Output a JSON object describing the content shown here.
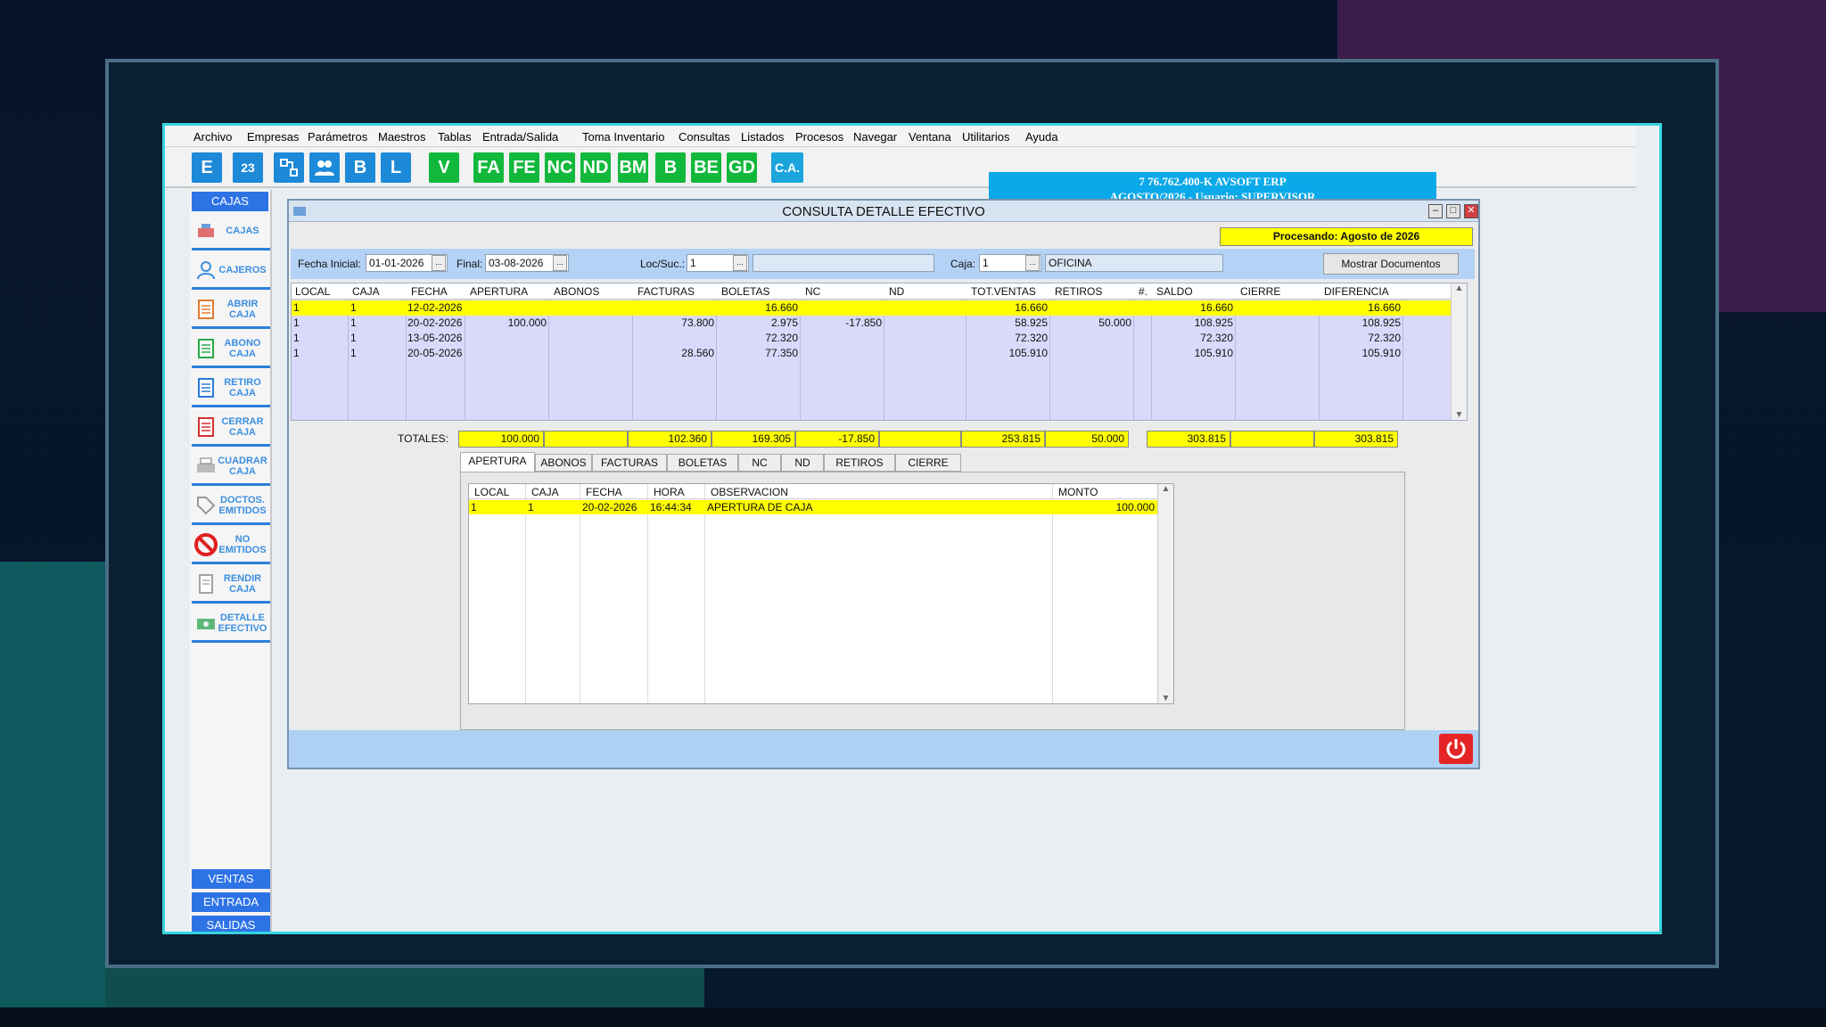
{
  "menu": [
    "Archivo",
    "Empresas",
    "Parámetros",
    "Maestros",
    "Tablas",
    "Entrada/Salida",
    "Toma Inventario",
    "Consultas",
    "Listados",
    "Procesos",
    "Navegar",
    "Ventana",
    "Utilitarios",
    "Ayuda"
  ],
  "toolbar": {
    "buttons": [
      "E",
      "23",
      "",
      "",
      "B",
      "L",
      "V",
      "FA",
      "FE",
      "NC",
      "ND",
      "BM",
      "B",
      "BE",
      "GD",
      "C.A."
    ],
    "banner_line1": "7  76.762.400-K  AVSOFT ERP",
    "banner_line2": "AGOSTO/2026  -  Usuario: SUPERVISOR"
  },
  "sidebar": {
    "header": "CAJAS",
    "items": [
      "CAJAS",
      "CAJEROS",
      "ABRIR\nCAJA",
      "ABONO\nCAJA",
      "RETIRO\nCAJA",
      "CERRAR\nCAJA",
      "CUADRAR\nCAJA",
      "DOCTOS.\nEMITIDOS",
      "NO\nEMITIDOS",
      "RENDIR\nCAJA",
      "DETALLE\nEFECTIVO"
    ],
    "footer": [
      "VENTAS",
      "ENTRADA",
      "SALIDAS"
    ]
  },
  "window": {
    "title": "CONSULTA DETALLE EFECTIVO",
    "processing": "Procesando: Agosto de 2026"
  },
  "filters": {
    "fecha_inicial_label": "Fecha Inicial:",
    "fecha_inicial": "01-01-2026",
    "final_label": "Final:",
    "final": "03-08-2026",
    "loc_label": "Loc/Suc.:",
    "loc": "1",
    "loc_name": "",
    "caja_label": "Caja:",
    "caja": "1",
    "caja_name": "OFICINA",
    "show_button": "Mostrar Documentos"
  },
  "grid": {
    "columns": [
      "LOCAL",
      "CAJA",
      "FECHA",
      "APERTURA",
      "ABONOS",
      "FACTURAS",
      "BOLETAS",
      "NC",
      "ND",
      "TOT.VENTAS",
      "RETIROS",
      "#.",
      "SALDO",
      "CIERRE",
      "DIFERENCIA"
    ],
    "rows": [
      [
        "1",
        "1",
        "12-02-2026",
        "",
        "",
        "",
        "16.660",
        "",
        "",
        "16.660",
        "",
        "",
        "16.660",
        "",
        "16.660"
      ],
      [
        "1",
        "1",
        "20-02-2026",
        "100.000",
        "",
        "73.800",
        "2.975",
        "-17.850",
        "",
        "58.925",
        "50.000",
        "",
        "108.925",
        "",
        "108.925"
      ],
      [
        "1",
        "1",
        "13-05-2026",
        "",
        "",
        "",
        "72.320",
        "",
        "",
        "72.320",
        "",
        "",
        "72.320",
        "",
        "72.320"
      ],
      [
        "1",
        "1",
        "20-05-2026",
        "",
        "",
        "28.560",
        "77.350",
        "",
        "",
        "105.910",
        "",
        "",
        "105.910",
        "",
        "105.910"
      ]
    ]
  },
  "totals": {
    "label": "TOTALES:",
    "values": [
      "100.000",
      "",
      "102.360",
      "169.305",
      "-17.850",
      "",
      "253.815",
      "50.000",
      "303.815",
      "",
      "303.815"
    ]
  },
  "tabs": [
    "APERTURA",
    "ABONOS",
    "FACTURAS",
    "BOLETAS",
    "NC",
    "ND",
    "RETIROS",
    "CIERRE"
  ],
  "detail": {
    "columns": [
      "LOCAL",
      "CAJA",
      "FECHA",
      "HORA",
      "OBSERVACION",
      "MONTO"
    ],
    "rows": [
      [
        "1",
        "1",
        "20-02-2026",
        "16:44:34",
        "APERTURA DE CAJA",
        "100.000"
      ]
    ]
  }
}
